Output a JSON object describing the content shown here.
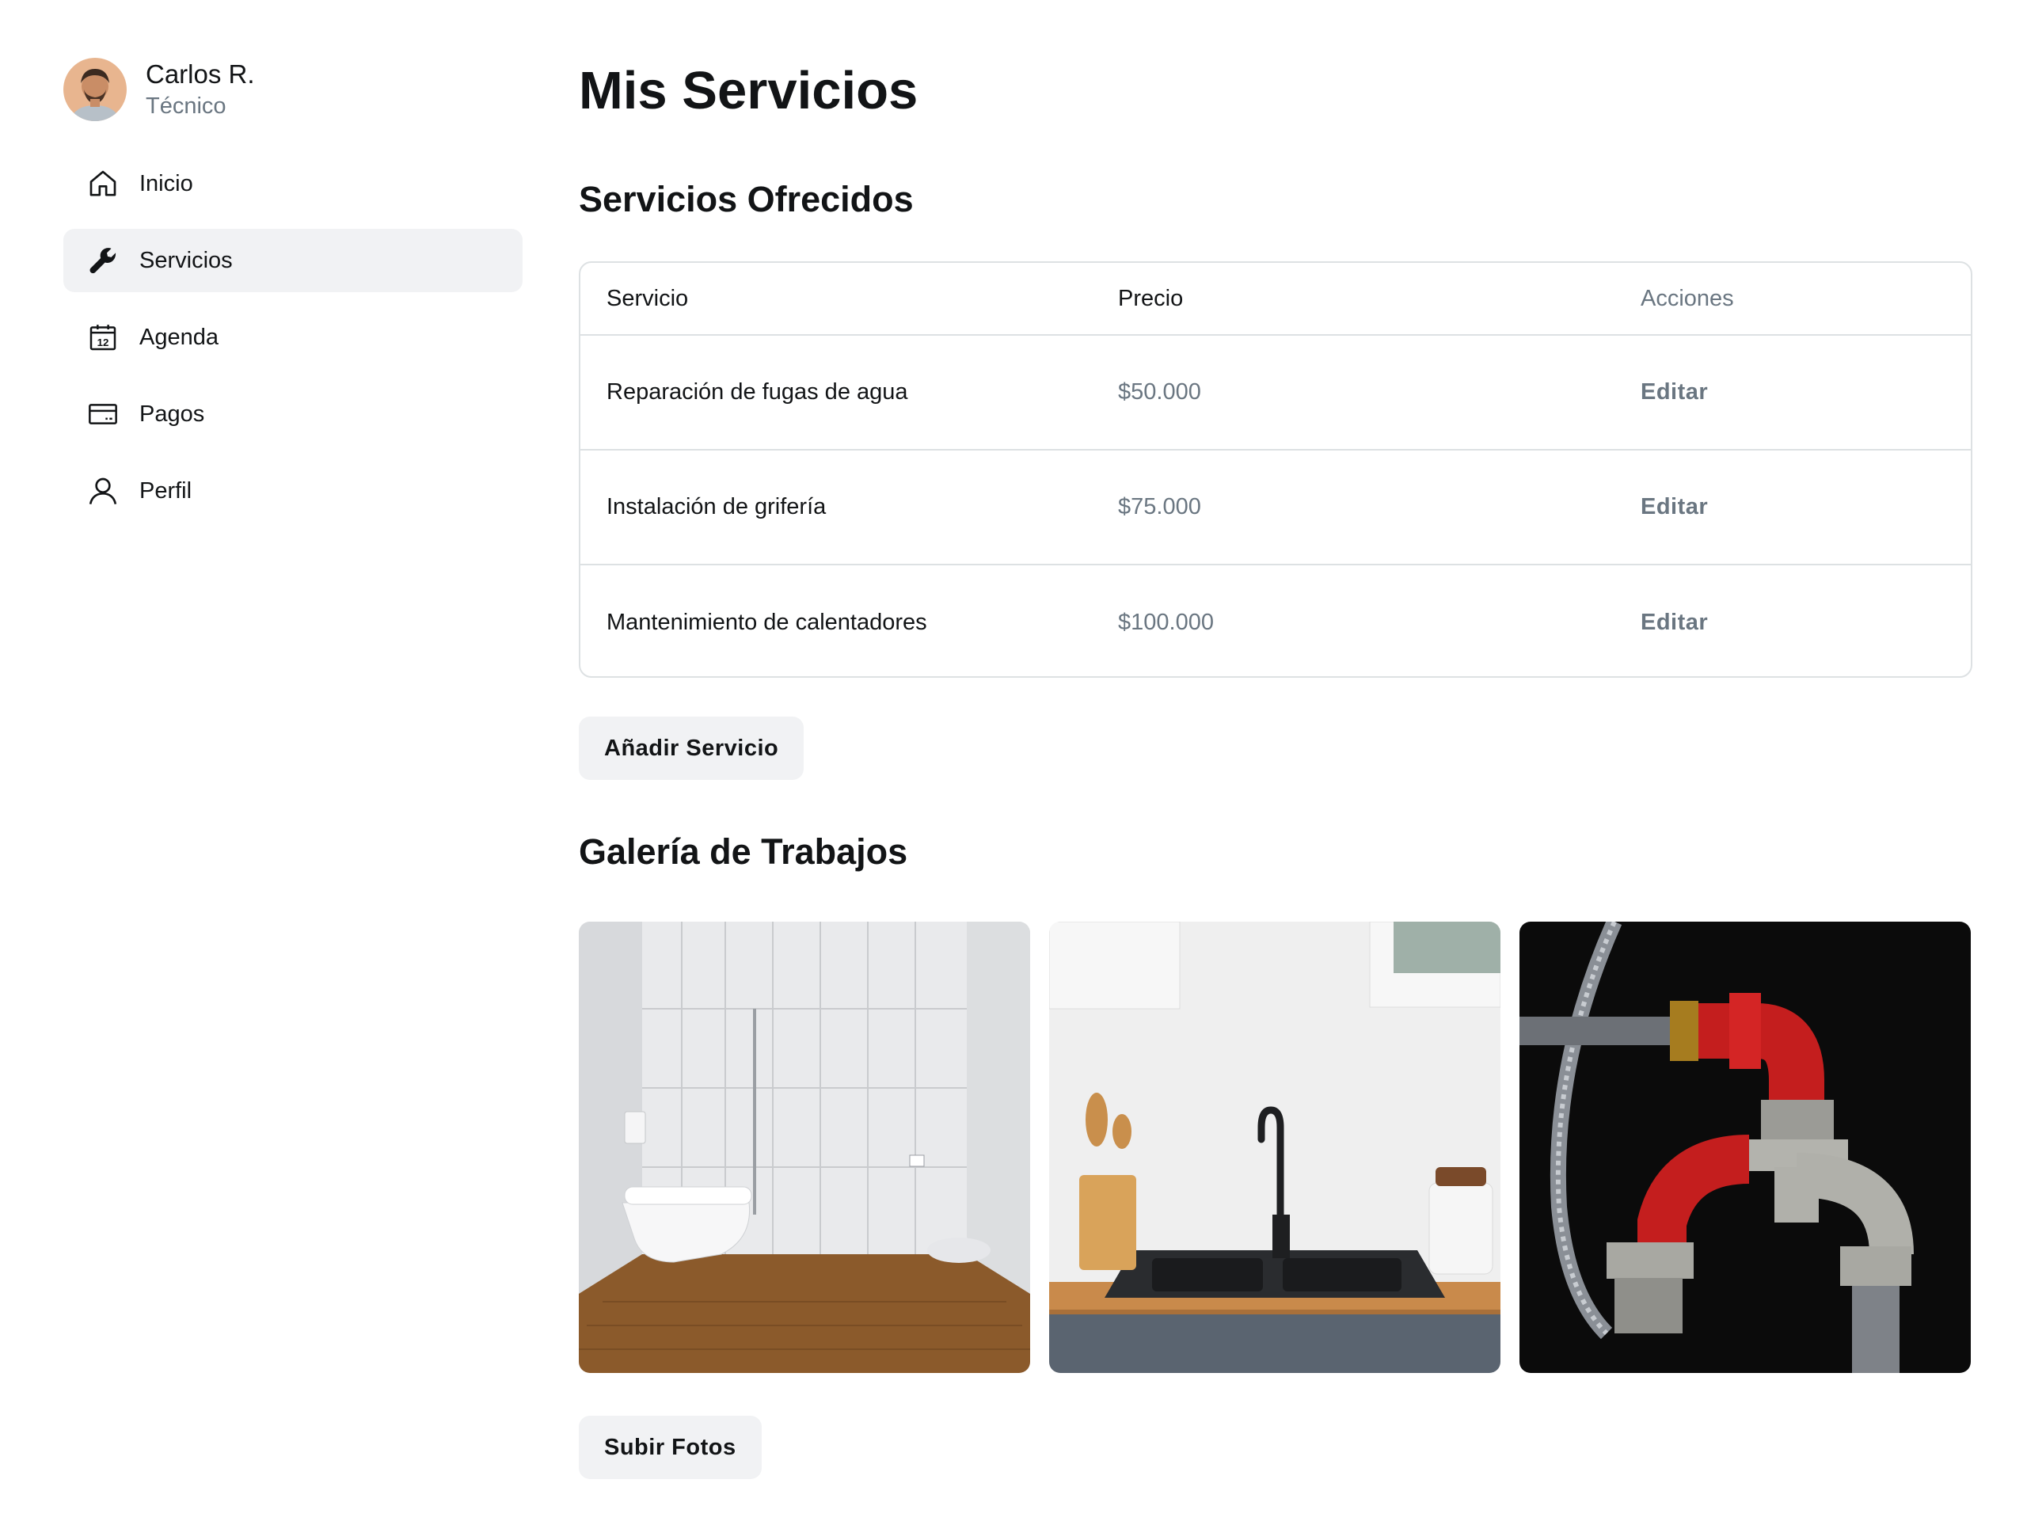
{
  "user": {
    "name": "Carlos R.",
    "role": "Técnico",
    "avatar_icon": "user-avatar"
  },
  "nav": {
    "items": [
      {
        "label": "Inicio",
        "icon": "home-icon",
        "active": false
      },
      {
        "label": "Servicios",
        "icon": "wrench-icon",
        "active": true
      },
      {
        "label": "Agenda",
        "icon": "calendar-icon",
        "active": false,
        "icon_text": "12"
      },
      {
        "label": "Pagos",
        "icon": "credit-card-icon",
        "active": false
      },
      {
        "label": "Perfil",
        "icon": "user-icon",
        "active": false
      }
    ]
  },
  "page": {
    "title": "Mis Servicios"
  },
  "services": {
    "heading": "Servicios Ofrecidos",
    "columns": [
      "Servicio",
      "Precio",
      "Acciones"
    ],
    "rows": [
      {
        "service": "Reparación de fugas de agua",
        "price": "$50.000",
        "action": "Editar"
      },
      {
        "service": "Instalación de grifería",
        "price": "$75.000",
        "action": "Editar"
      },
      {
        "service": "Mantenimiento de calentadores",
        "price": "$100.000",
        "action": "Editar"
      }
    ],
    "add_button": "Añadir Servicio"
  },
  "gallery": {
    "heading": "Galería de Trabajos",
    "photos": [
      "bathroom-photo",
      "kitchen-sink-photo",
      "pipes-photo"
    ],
    "upload_button": "Subir Fotos"
  },
  "colors": {
    "text_primary": "#121416",
    "text_secondary": "#6a7681",
    "surface": "#f1f2f4",
    "border": "#dde1e3"
  }
}
